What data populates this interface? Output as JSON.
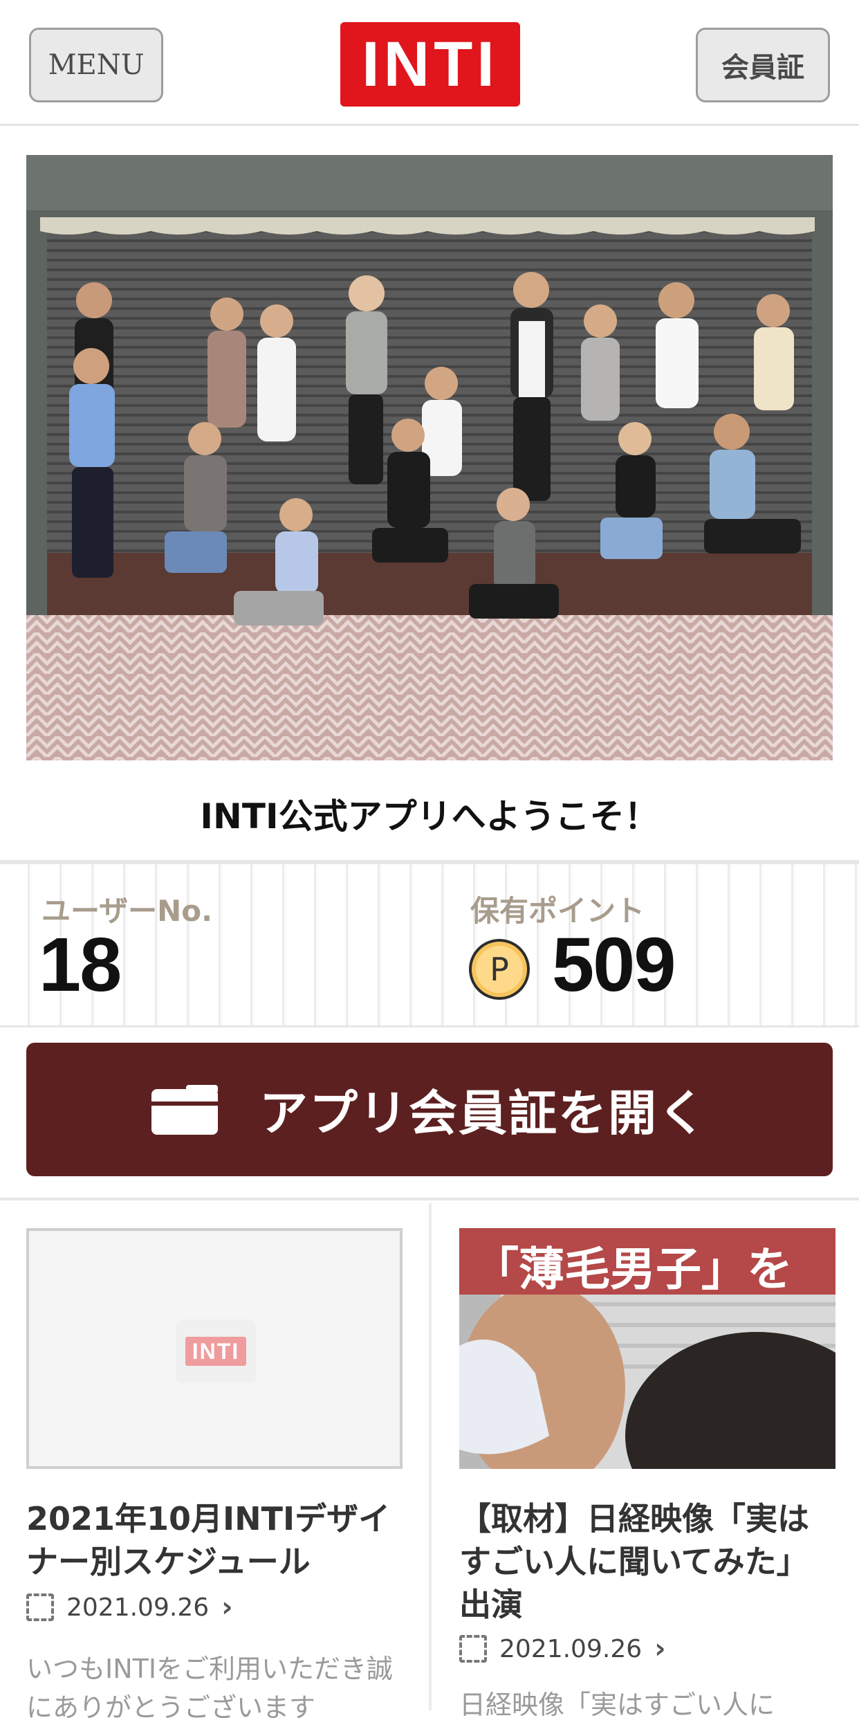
{
  "header": {
    "menu_label": "MENU",
    "logo_text": "INTI",
    "card_label": "会員証",
    "brand_color": "#e0161c"
  },
  "hero": {
    "image_desc": "staff-group-photo",
    "welcome": "INTI公式アプリへようこそ！"
  },
  "stats": {
    "user_label": "ユーザーNo.",
    "user_no": "18",
    "points_label": "保有ポイント",
    "coin_symbol": "P",
    "points": "509"
  },
  "member_button": {
    "label": "アプリ会員証を開く",
    "icon": "wallet-icon",
    "color": "#5d2020"
  },
  "articles": [
    {
      "thumb_logo": "INTI",
      "title": "2021年10月INTIデザイナー別スケジュール",
      "date": "2021.09.26",
      "excerpt": "いつもINTIをご利用いただき誠にありがとうございます"
    },
    {
      "thumb_caption": "「薄毛男子」を",
      "title": "【取材】日経映像「実はすごい人に聞いてみた」出演",
      "date": "2021.09.26",
      "excerpt": "日経映像「実はすごい人に"
    }
  ]
}
